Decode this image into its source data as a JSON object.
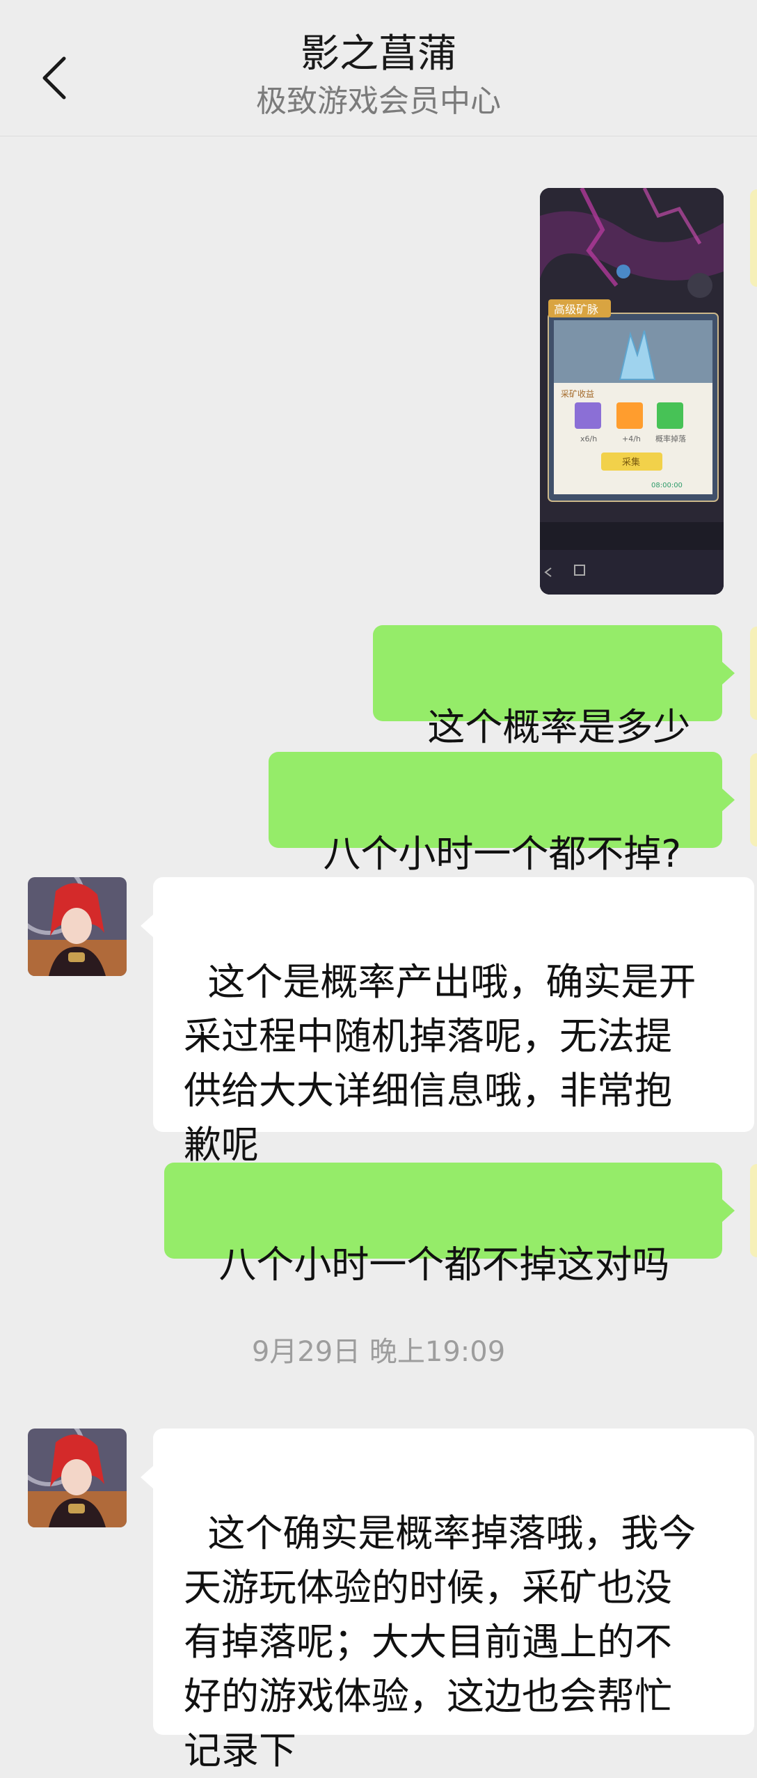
{
  "header": {
    "title": "影之菖蒲",
    "subtitle": "极致游戏会员中心"
  },
  "messages": {
    "m1": {
      "text": "这个概率是多少"
    },
    "m2": {
      "text": "八个小时一个都不掉?"
    },
    "m3": {
      "text": "这个是概率产出哦，确实是开\n采过程中随机掉落呢，无法提\n供给大大详细信息哦，非常抱\n歉呢"
    },
    "m4": {
      "text": "八个小时一个都不掉这对吗"
    },
    "m5": {
      "text": "这个确实是概率掉落哦，我今\n天游玩体验的时候，采矿也没\n有掉落呢；大大目前遇上的不\n好的游戏体验，这边也会帮忙\n记录下"
    }
  },
  "timestamp": "9月29日 晚上19:09",
  "screenshot_message": {
    "panel_title": "高级矿脉",
    "rewards_label": "采矿收益",
    "items": [
      {
        "label": "x6/h",
        "color": "#8b6fd6"
      },
      {
        "label": "+4/h",
        "color": "#ff9d2e"
      },
      {
        "label": "概率掉落",
        "color": "#47c256"
      }
    ],
    "action_button": "采集",
    "time_text": "08:00:00"
  },
  "colors": {
    "outgoing_bubble": "#95ec69",
    "incoming_bubble": "#ffffff",
    "background": "#ededed"
  }
}
